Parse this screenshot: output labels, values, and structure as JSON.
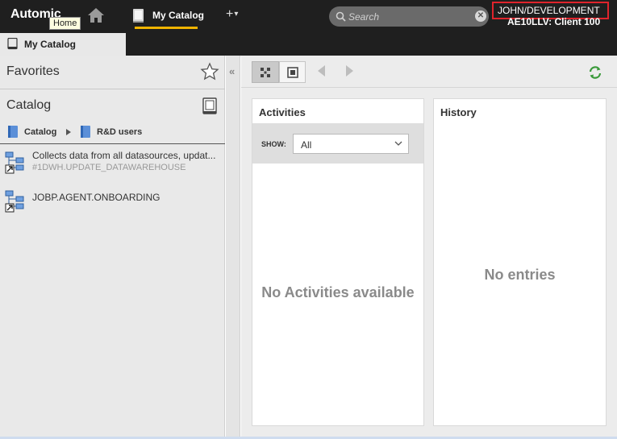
{
  "header": {
    "logo_text": "Automic",
    "home_tooltip": "Home",
    "nav_catalog_label": "My Catalog",
    "add_menu_label": "+",
    "search_placeholder": "Search",
    "user": "JOHN/DEVELOPMENT",
    "client": "AE10LLV: Client 100"
  },
  "tabs": [
    {
      "label": "My Catalog",
      "active": true
    }
  ],
  "left_panel": {
    "favorites_title": "Favorites",
    "catalog_title": "Catalog",
    "breadcrumb": [
      "Catalog",
      "R&D users"
    ],
    "items": [
      {
        "name": "Collects data from all datasources, updat...",
        "id": "#1DWH.UPDATE_DATAWAREHOUSE"
      },
      {
        "name": "JOBP.AGENT.ONBOARDING",
        "id": ""
      }
    ]
  },
  "activities": {
    "title": "Activities",
    "show_label": "SHOW:",
    "show_value": "All",
    "empty_text": "No Activities available"
  },
  "history": {
    "title": "History",
    "empty_text": "No entries"
  },
  "colors": {
    "topbar": "#1f1f1f",
    "accent_underline": "#f0b400",
    "user_highlight": "#e0242c",
    "refresh_green": "#3a9a3a"
  }
}
